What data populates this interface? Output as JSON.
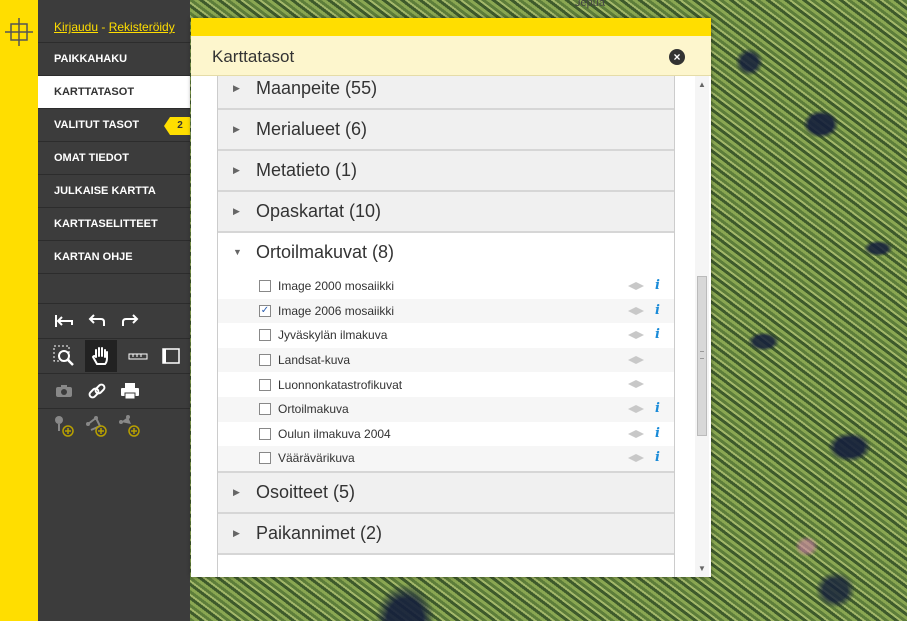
{
  "map": {
    "place_label": "Jepua"
  },
  "auth": {
    "login": "Kirjaudu",
    "separator": " - ",
    "register": "Rekisteröidy"
  },
  "nav": [
    {
      "label": "PAIKKAHAKU"
    },
    {
      "label": "KARTTATASOT",
      "active": true
    },
    {
      "label": "VALITUT TASOT",
      "badge": "2"
    },
    {
      "label": "OMAT TIEDOT"
    },
    {
      "label": "JULKAISE KARTTA"
    },
    {
      "label": "KARTTASELITTEET"
    },
    {
      "label": "KARTAN OHJE"
    }
  ],
  "tools": {
    "row1": [
      "reset-view-icon",
      "undo-icon",
      "redo-icon"
    ],
    "row2": [
      "zoom-box-icon",
      "pan-hand-icon",
      "measure-line-icon",
      "measure-area-icon"
    ],
    "row3": [
      "camera-icon",
      "link-icon",
      "print-icon"
    ],
    "row4": [
      "add-point-icon",
      "add-line-icon",
      "add-area-icon"
    ]
  },
  "panel": {
    "title": "Karttatasot",
    "close": "×",
    "groups_before": [
      {
        "label": "Maanpeite (55)"
      },
      {
        "label": "Merialueet (6)"
      },
      {
        "label": "Metatieto (1)"
      },
      {
        "label": "Opaskartat (10)"
      }
    ],
    "open_group": {
      "label": "Ortoilmakuvat (8)",
      "layers": [
        {
          "name": "Image 2000 mosaiikki",
          "checked": false,
          "info": true
        },
        {
          "name": "Image 2006 mosaiikki",
          "checked": true,
          "info": true
        },
        {
          "name": "Jyväskylän ilmakuva",
          "checked": false,
          "info": true
        },
        {
          "name": "Landsat-kuva",
          "checked": false,
          "info": false
        },
        {
          "name": "Luonnonkatastrofikuvat",
          "checked": false,
          "info": false
        },
        {
          "name": "Ortoilmakuva",
          "checked": false,
          "info": true
        },
        {
          "name": "Oulun ilmakuva 2004",
          "checked": false,
          "info": true
        },
        {
          "name": "Väärävärikuva",
          "checked": false,
          "info": true
        }
      ]
    },
    "groups_after": [
      {
        "label": "Osoitteet (5)"
      },
      {
        "label": "Paikannimet (2)"
      }
    ],
    "info_glyph": "i"
  },
  "colors": {
    "accent": "#ffde00",
    "sidebar": "#3c3c3c",
    "info": "#1a8bd8"
  }
}
